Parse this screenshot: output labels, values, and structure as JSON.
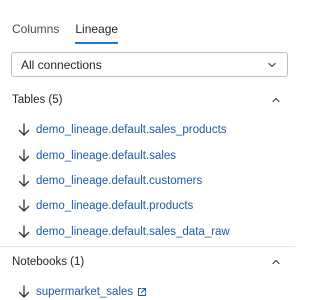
{
  "tabs": [
    {
      "label": "Columns",
      "active": false
    },
    {
      "label": "Lineage",
      "active": true
    }
  ],
  "connections_select": {
    "value": "All connections"
  },
  "tables_section": {
    "title": "Tables (5)",
    "items": [
      {
        "label": "demo_lineage.default.sales_products"
      },
      {
        "label": "demo_lineage.default.sales"
      },
      {
        "label": "demo_lineage.default.customers"
      },
      {
        "label": "demo_lineage.default.products"
      },
      {
        "label": "demo_lineage.default.sales_data_raw"
      }
    ]
  },
  "notebooks_section": {
    "title": "Notebooks (1)",
    "items": [
      {
        "label": "supermarket_sales"
      }
    ]
  },
  "colors": {
    "accent": "#1b7bd1",
    "link": "#1e5aa8",
    "text": "#1f2328",
    "border": "#b9c0c8"
  }
}
